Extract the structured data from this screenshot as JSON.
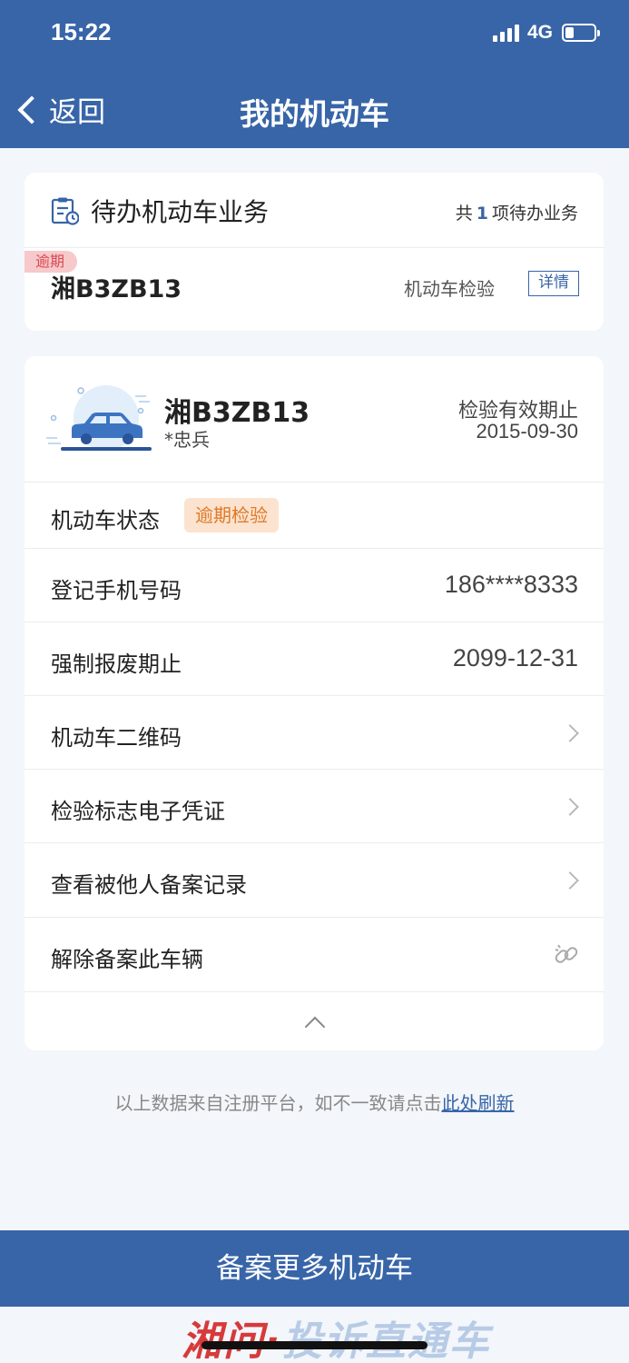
{
  "status_bar": {
    "time": "15:22",
    "network": "4G",
    "battery_level": 0.2
  },
  "nav": {
    "back_label": "返回",
    "title": "我的机动车"
  },
  "pending": {
    "title": "待办机动车业务",
    "count_prefix": "共",
    "count": "1",
    "count_suffix": "项待办业务",
    "badge": "逾期",
    "plate": "湘B3ZB13",
    "service": "机动车检验",
    "detail_label": "详情"
  },
  "vehicle": {
    "plate": "湘B3ZB13",
    "owner": "*忠兵",
    "valid_label": "检验有效期止",
    "valid_date": "2015-09-30"
  },
  "rows": {
    "status": {
      "label": "机动车状态",
      "badge": "逾期检验"
    },
    "phone": {
      "label": "登记手机号码",
      "value": "186****8333"
    },
    "scrap": {
      "label": "强制报废期止",
      "value": "2099-12-31"
    },
    "qrcode": {
      "label": "机动车二维码"
    },
    "certificate": {
      "label": "检验标志电子凭证"
    },
    "records": {
      "label": "查看被他人备案记录"
    },
    "unbind": {
      "label": "解除备案此车辆"
    }
  },
  "footnote": {
    "text": "以上数据来自注册平台，如不一致请点击",
    "link": "此处刷新"
  },
  "bottom_button": {
    "label": "备案更多机动车"
  },
  "watermark": {
    "part1": "湘问·",
    "part2": "投诉直通车"
  },
  "colors": {
    "primary": "#3865a8",
    "overdue": "#d84a52",
    "warning": "#e07a27"
  }
}
